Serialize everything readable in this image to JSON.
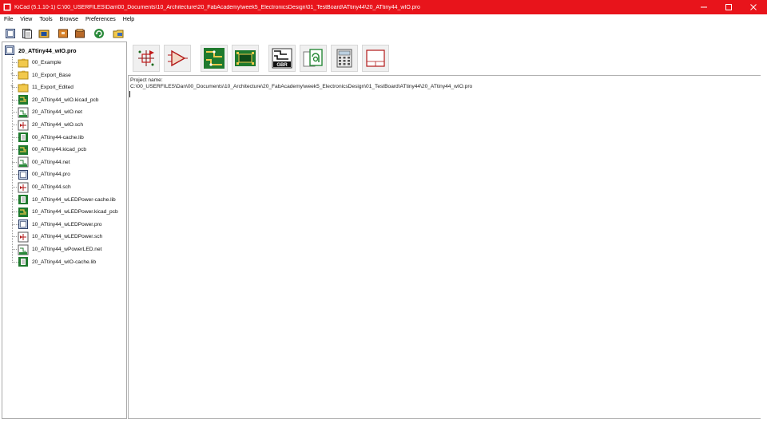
{
  "window": {
    "title": "KiCad (5.1.10-1) C:\\00_USERFILES\\Dan\\00_Documents\\10_Architecture\\20_FabAcademy\\week5_ElectronicsDesign\\01_TestBoard\\ATtiny44\\20_ATtiny44_wIO.pro",
    "controls": [
      "minimize-icon",
      "maximize-icon",
      "close-icon"
    ]
  },
  "menu": [
    "File",
    "View",
    "Tools",
    "Browse",
    "Preferences",
    "Help"
  ],
  "toolbar": {
    "buttons": [
      "new-project-icon",
      "new-project-template-icon",
      "open-project-icon",
      "archive-icon",
      "unarchive-icon",
      "refresh-icon",
      "open-folder-icon"
    ]
  },
  "tree": {
    "root": "20_ATtiny44_wIO.pro",
    "items": [
      {
        "label": "00_Example",
        "icon": "folder-icon"
      },
      {
        "label": "10_Export_Base",
        "icon": "folder-icon"
      },
      {
        "label": "11_Export_Edited",
        "icon": "folder-icon"
      },
      {
        "label": "20_ATtiny44_wIO.kicad_pcb",
        "icon": "pcb-file-icon"
      },
      {
        "label": "20_ATtiny44_wIO.net",
        "icon": "netlist-file-icon"
      },
      {
        "label": "20_ATtiny44_wIO.sch",
        "icon": "schematic-file-icon"
      },
      {
        "label": "00_ATtiny44-cache.lib",
        "icon": "library-file-icon"
      },
      {
        "label": "00_ATtiny44.kicad_pcb",
        "icon": "pcb-file-icon"
      },
      {
        "label": "00_ATtiny44.net",
        "icon": "netlist-file-icon"
      },
      {
        "label": "00_ATtiny44.pro",
        "icon": "project-file-icon"
      },
      {
        "label": "00_ATtiny44.sch",
        "icon": "schematic-file-icon"
      },
      {
        "label": "10_ATtiny44_wLEDPower-cache.lib",
        "icon": "library-file-icon"
      },
      {
        "label": "10_ATtiny44_wLEDPower.kicad_pcb",
        "icon": "pcb-file-icon"
      },
      {
        "label": "10_ATtiny44_wLEDPower.pro",
        "icon": "project-file-icon"
      },
      {
        "label": "10_ATtiny44_wLEDPower.sch",
        "icon": "schematic-file-icon"
      },
      {
        "label": "10_ATtiny44_wPowerLED.net",
        "icon": "netlist-file-icon"
      },
      {
        "label": "20_ATtiny44_wIO-cache.lib",
        "icon": "library-file-icon"
      }
    ]
  },
  "launcher": {
    "buttons": [
      "schematic-editor-icon",
      "symbol-editor-icon",
      "pcb-editor-icon",
      "footprint-editor-icon",
      "gerber-viewer-icon",
      "bitmap-converter-icon",
      "pcb-calculator-icon",
      "page-layout-editor-icon"
    ]
  },
  "messages": {
    "label": "Project name:",
    "path": "C:\\00_USERFILES\\Dan\\00_Documents\\10_Architecture\\20_FabAcademy\\week5_ElectronicsDesign\\01_TestBoard\\ATtiny44\\20_ATtiny44_wIO.pro"
  },
  "colors": {
    "titlebar": "#e8141b",
    "pcb_green": "#1f7a2e",
    "folder_yellow": "#f2c94c"
  }
}
